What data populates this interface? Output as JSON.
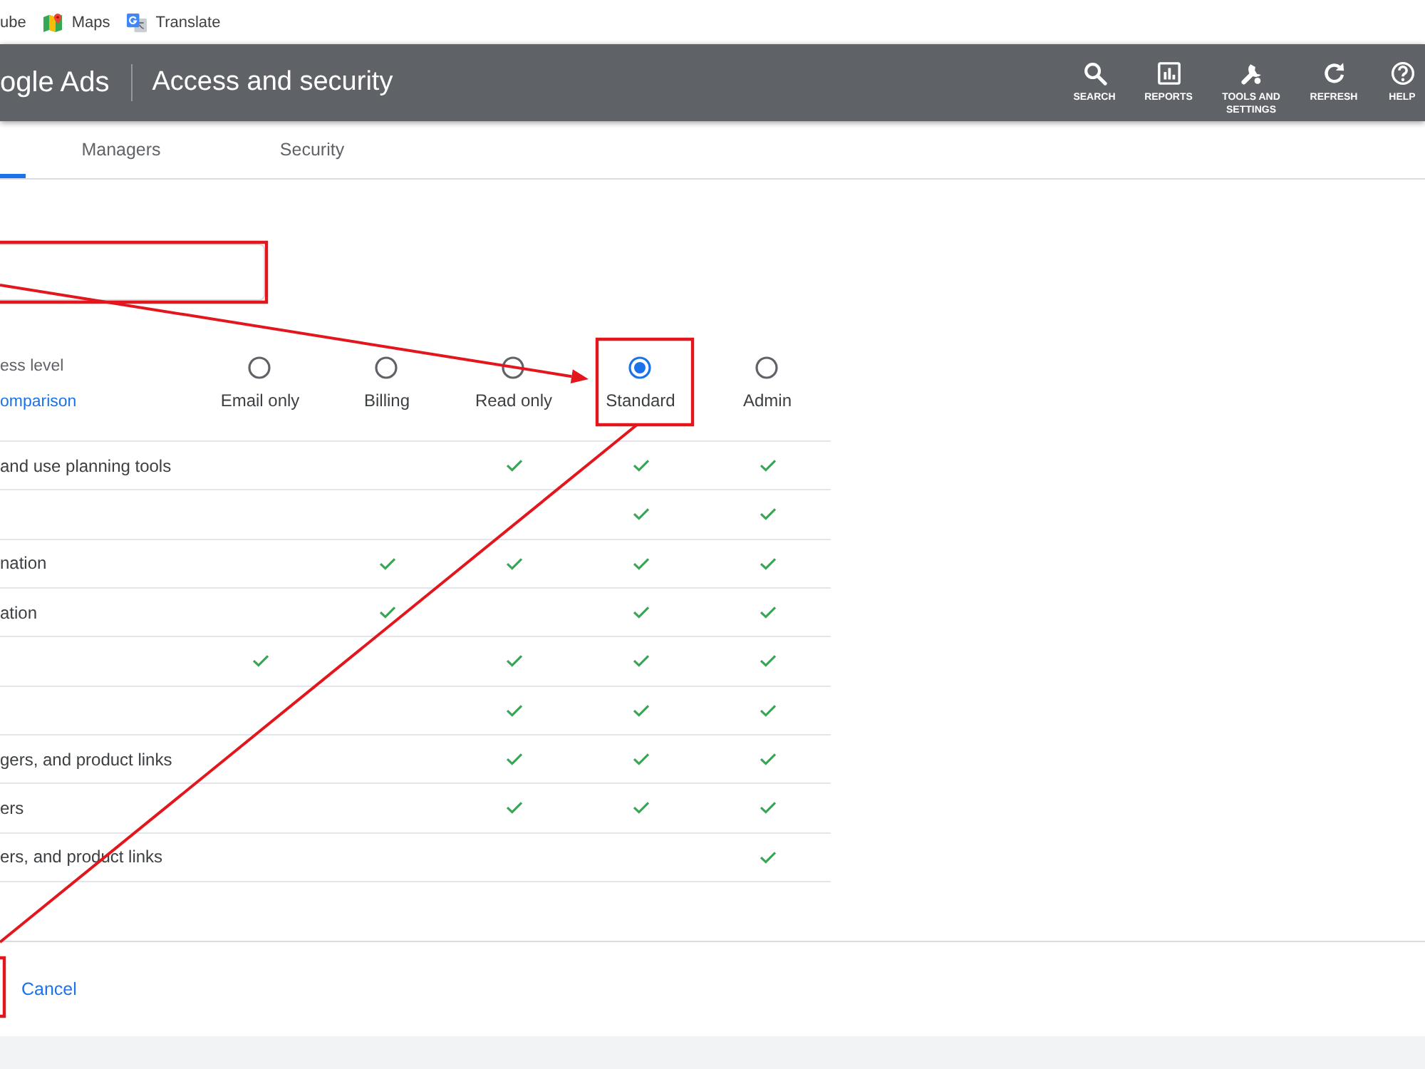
{
  "bookmarks_bar": {
    "items": [
      {
        "label": "ube"
      },
      {
        "label": "Maps"
      },
      {
        "label": "Translate"
      }
    ]
  },
  "header": {
    "product": "ogle Ads",
    "page_title": "Access and security",
    "actions": [
      {
        "label": "SEARCH"
      },
      {
        "label": "REPORTS"
      },
      {
        "label": "TOOLS AND SETTINGS"
      },
      {
        "label": "REFRESH"
      },
      {
        "label": "HELP"
      }
    ]
  },
  "tabs": [
    {
      "selected": true
    },
    {
      "label": "Managers",
      "selected": false
    },
    {
      "label": "Security",
      "selected": false
    }
  ],
  "access_level": {
    "label": "ess level",
    "link": "omparison",
    "options": [
      {
        "label": "Email only",
        "selected": false
      },
      {
        "label": "Billing",
        "selected": false
      },
      {
        "label": "Read only",
        "selected": false
      },
      {
        "label": "Standard",
        "selected": true
      },
      {
        "label": "Admin",
        "selected": false
      }
    ]
  },
  "permissions_table": {
    "rows": [
      {
        "label": "and use planning tools",
        "granted": [
          false,
          false,
          true,
          true,
          true
        ]
      },
      {
        "granted": [
          false,
          false,
          false,
          true,
          true
        ]
      },
      {
        "label": "nation",
        "granted": [
          false,
          true,
          true,
          true,
          true
        ]
      },
      {
        "label": "ation",
        "granted": [
          false,
          true,
          false,
          true,
          true
        ]
      },
      {
        "granted": [
          true,
          false,
          true,
          true,
          true
        ]
      },
      {
        "granted": [
          false,
          false,
          true,
          true,
          true
        ]
      },
      {
        "label": "gers, and product links",
        "granted": [
          false,
          false,
          true,
          true,
          true
        ]
      },
      {
        "label": "ers",
        "granted": [
          false,
          false,
          true,
          true,
          true
        ]
      },
      {
        "label": "ers, and product links",
        "granted": [
          false,
          false,
          false,
          false,
          true
        ]
      }
    ]
  },
  "footer": {
    "cancel": "Cancel"
  },
  "annotations": [
    {
      "kind": "box"
    },
    {
      "kind": "arrow"
    },
    {
      "kind": "box"
    },
    {
      "kind": "line"
    },
    {
      "kind": "box"
    }
  ]
}
